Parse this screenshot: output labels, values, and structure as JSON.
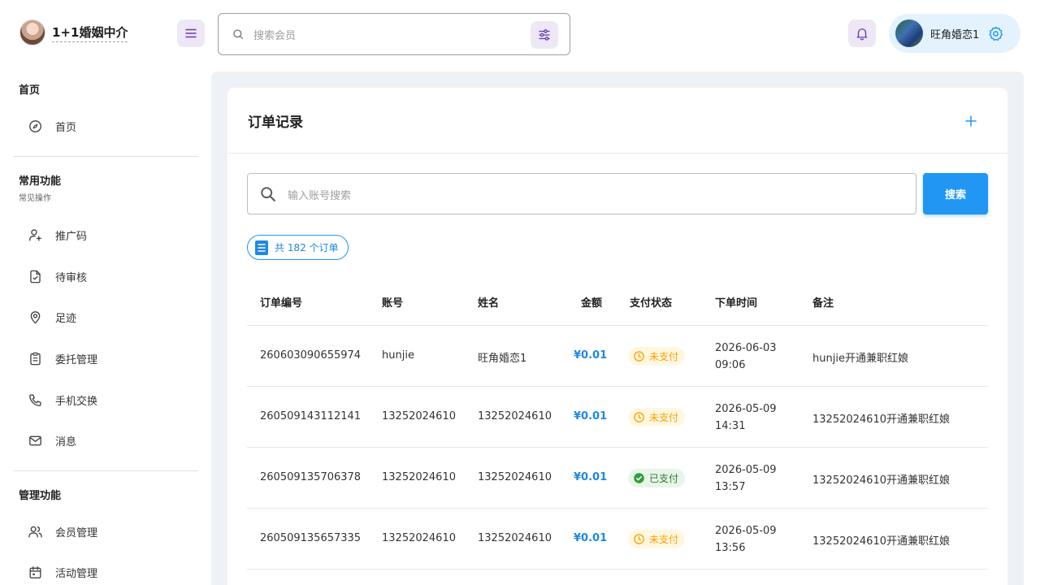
{
  "brand": {
    "name": "1+1婚姻中介"
  },
  "header": {
    "search_placeholder": "搜索会员",
    "user_name": "旺角婚恋1"
  },
  "sidebar": {
    "sections": [
      {
        "title": "首页",
        "subtitle": "",
        "items": [
          {
            "label": "首页",
            "icon": "dashboard-icon"
          }
        ]
      },
      {
        "title": "常用功能",
        "subtitle": "常见操作",
        "items": [
          {
            "label": "推广码",
            "icon": "user-plus-icon"
          },
          {
            "label": "待审核",
            "icon": "file-check-icon"
          },
          {
            "label": "足迹",
            "icon": "map-pin-icon"
          },
          {
            "label": "委托管理",
            "icon": "clipboard-icon"
          },
          {
            "label": "手机交换",
            "icon": "phone-icon"
          },
          {
            "label": "消息",
            "icon": "mail-icon"
          }
        ]
      },
      {
        "title": "管理功能",
        "subtitle": "",
        "items": [
          {
            "label": "会员管理",
            "icon": "users-icon"
          },
          {
            "label": "活动管理",
            "icon": "calendar-icon"
          }
        ]
      }
    ]
  },
  "main": {
    "title": "订单记录",
    "account_search_placeholder": "输入账号搜索",
    "search_button": "搜索",
    "count_text": "共 182 个订单",
    "columns": [
      "订单编号",
      "账号",
      "姓名",
      "金额",
      "支付状态",
      "下单时间",
      "备注"
    ],
    "rows": [
      {
        "order_no": "260603090655974",
        "account": "hunjie",
        "name": "旺角婚恋1",
        "amount": "¥0.01",
        "status": "未支付",
        "status_type": "unpaid",
        "time": "2026-06-03 09:06",
        "note": "hunjie开通兼职红娘"
      },
      {
        "order_no": "260509143112141",
        "account": "13252024610",
        "name": "13252024610",
        "amount": "¥0.01",
        "status": "未支付",
        "status_type": "unpaid",
        "time": "2026-05-09 14:31",
        "note": "13252024610开通兼职红娘"
      },
      {
        "order_no": "260509135706378",
        "account": "13252024610",
        "name": "13252024610",
        "amount": "¥0.01",
        "status": "已支付",
        "status_type": "paid",
        "time": "2026-05-09 13:57",
        "note": "13252024610开通兼职红娘"
      },
      {
        "order_no": "260509135657335",
        "account": "13252024610",
        "name": "13252024610",
        "amount": "¥0.01",
        "status": "未支付",
        "status_type": "unpaid",
        "time": "2026-05-09 13:56",
        "note": "13252024610开通兼职红娘"
      }
    ]
  },
  "colors": {
    "accent": "#2196f3",
    "secondary_bg": "#ede7f6",
    "secondary_fg": "#673ab7",
    "unpaid": "#ffa000",
    "paid": "#2e7d32"
  }
}
